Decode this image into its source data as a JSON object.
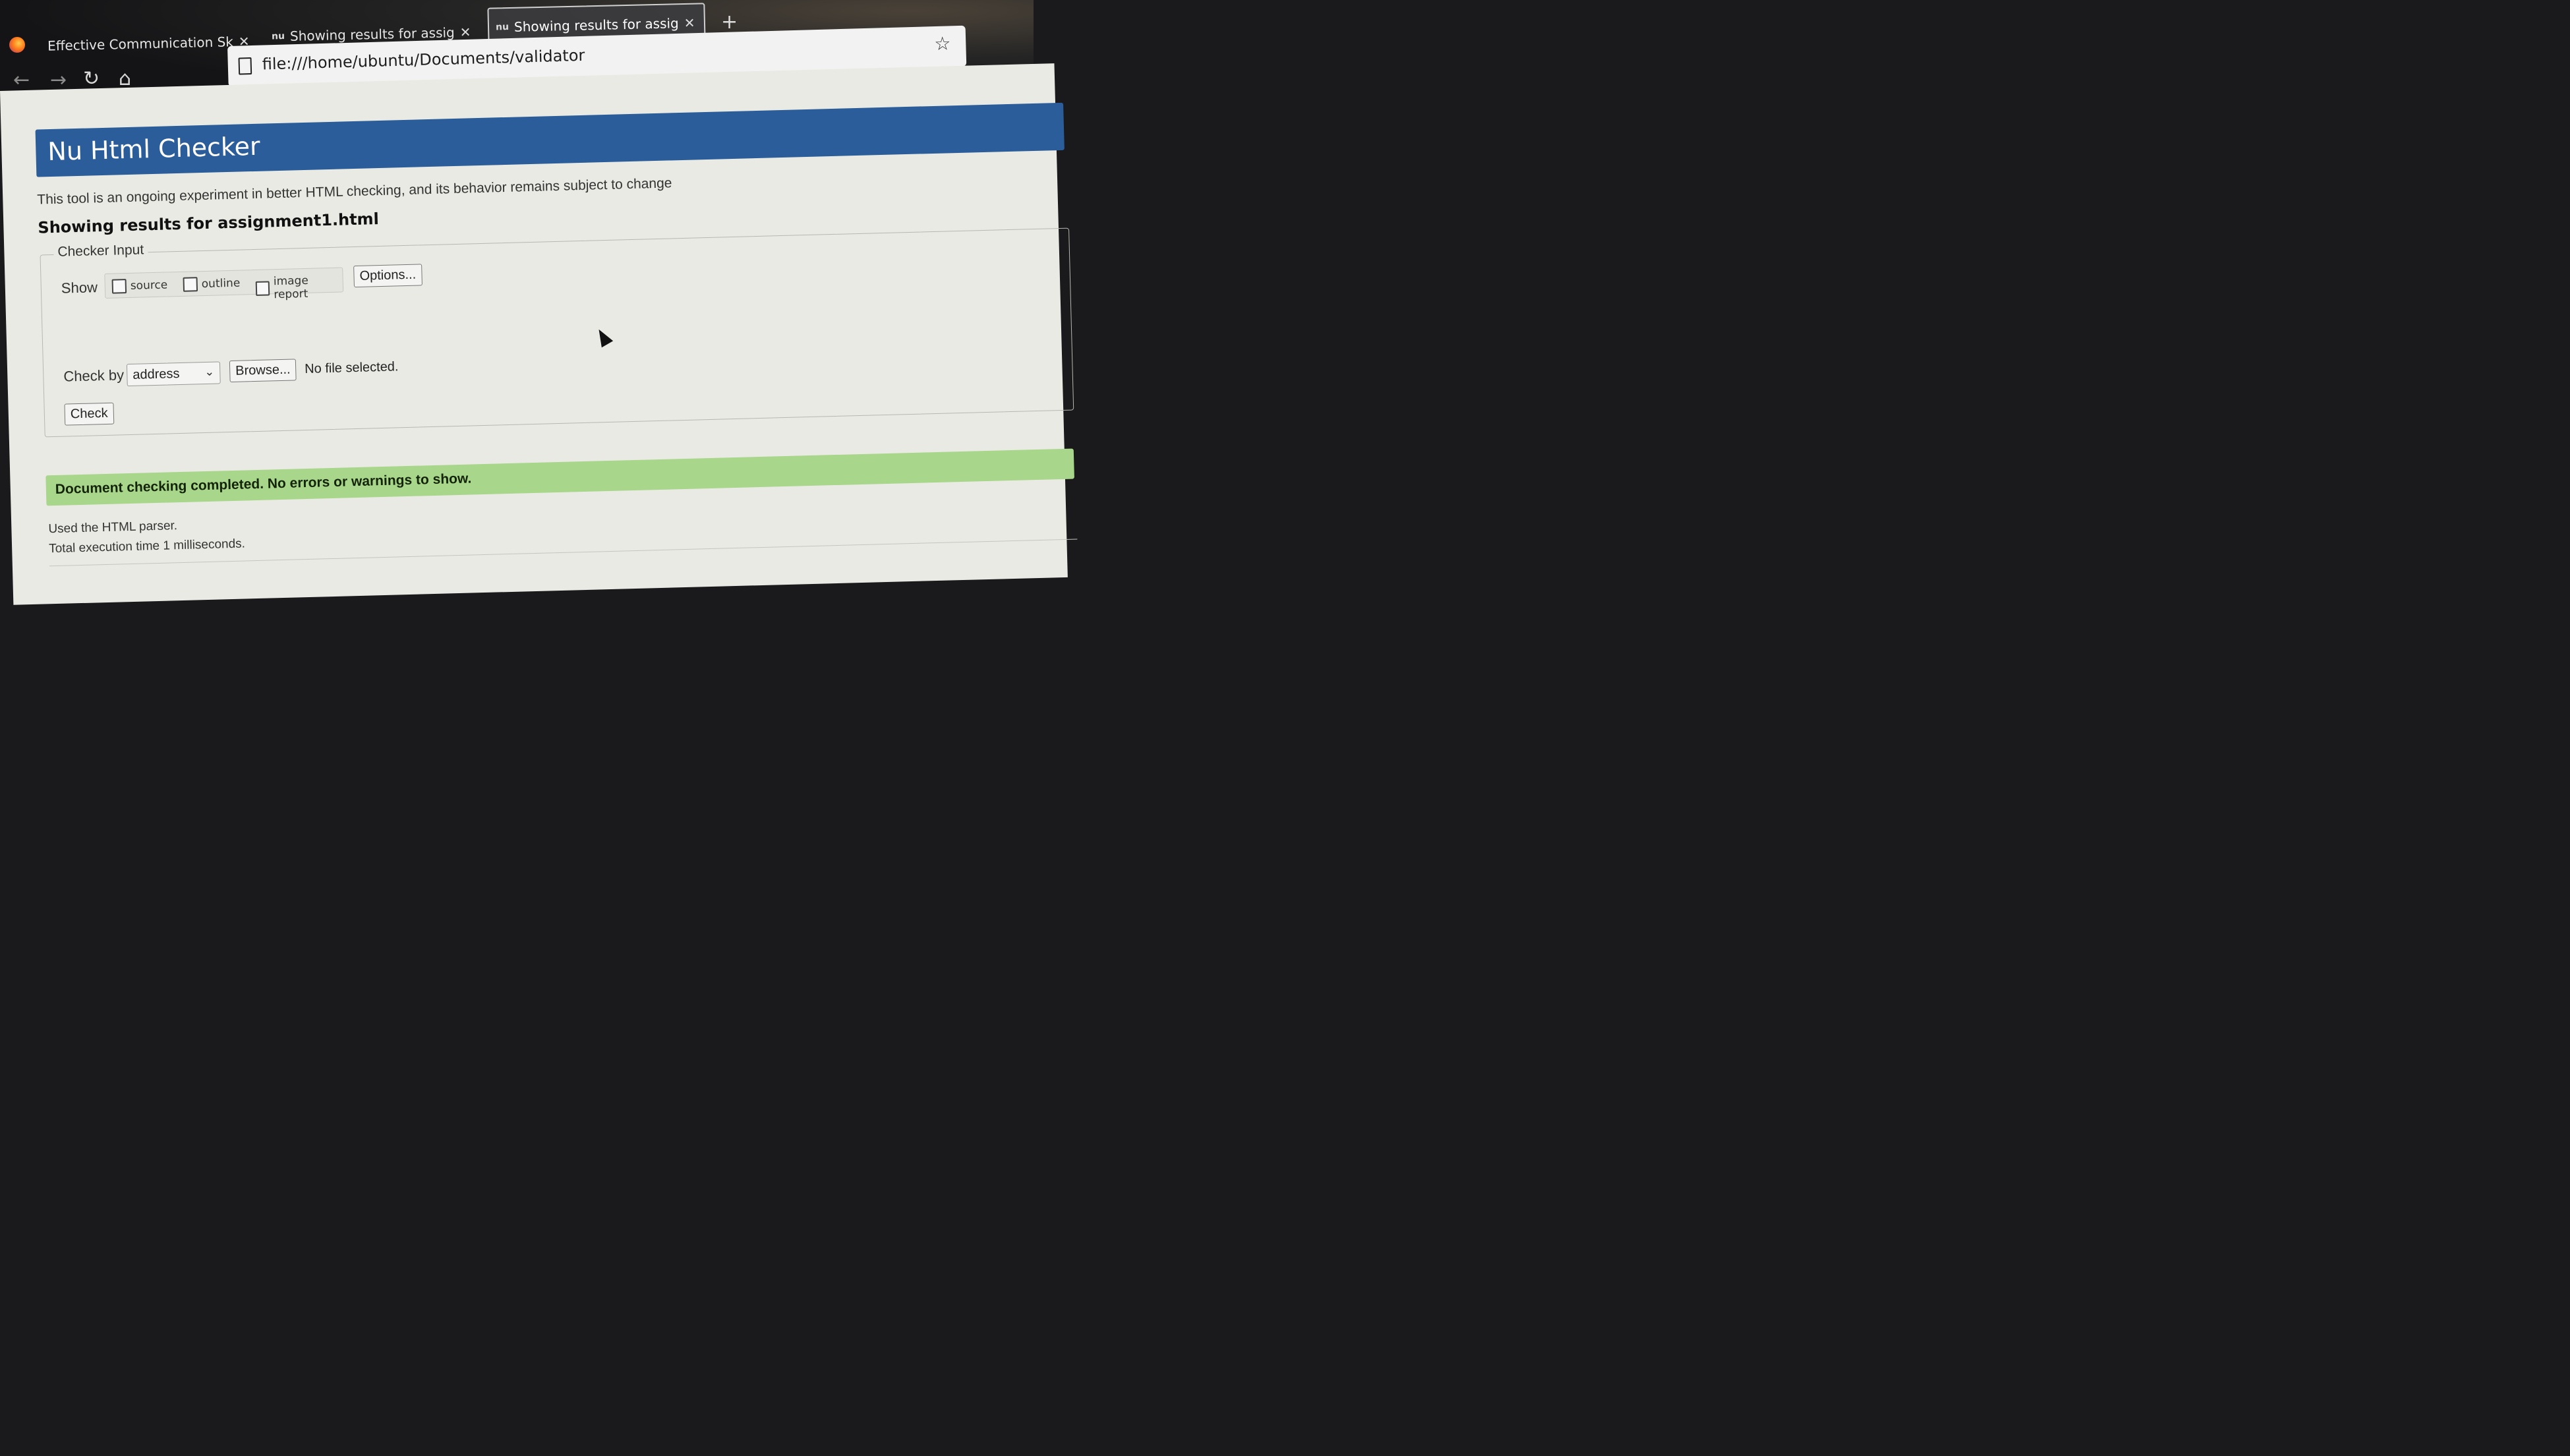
{
  "browser": {
    "tabs": [
      {
        "favicon": "",
        "title": "Effective Communication Sk",
        "active": false
      },
      {
        "favicon": "nu",
        "title": "Showing results for assig",
        "active": false
      },
      {
        "favicon": "nu",
        "title": "Showing results for assig",
        "active": true
      }
    ],
    "new_tab_label": "+",
    "url": "file:///home/ubuntu/Documents/validator",
    "icons": [
      "firefox-logo",
      "back-icon",
      "forward-icon",
      "reload-icon",
      "home-icon",
      "page-icon",
      "bookmark-star-icon",
      "close-icon"
    ]
  },
  "page": {
    "title": "Nu Html Checker",
    "intro": "This tool is an ongoing experiment in better HTML checking, and its behavior remains subject to change",
    "results_heading": "Showing results for assignment1.html",
    "checker_input": {
      "legend": "Checker Input",
      "show_label": "Show",
      "options": [
        {
          "label": "source",
          "checked": false
        },
        {
          "label": "outline",
          "checked": false
        },
        {
          "label": "image report",
          "checked": false
        }
      ],
      "options_button": "Options...",
      "check_by_label": "Check by",
      "check_by_value": "address",
      "browse_button": "Browse...",
      "no_file": "No file selected.",
      "check_button": "Check"
    },
    "success_message": "Document checking completed. No errors or warnings to show.",
    "parser_note": "Used the HTML parser.",
    "exec_time": "Total execution time 1 milliseconds."
  },
  "colors": {
    "header_bg": "#2a5d99",
    "success_bg": "#a8d68a",
    "page_bg": "#eaeae4"
  }
}
